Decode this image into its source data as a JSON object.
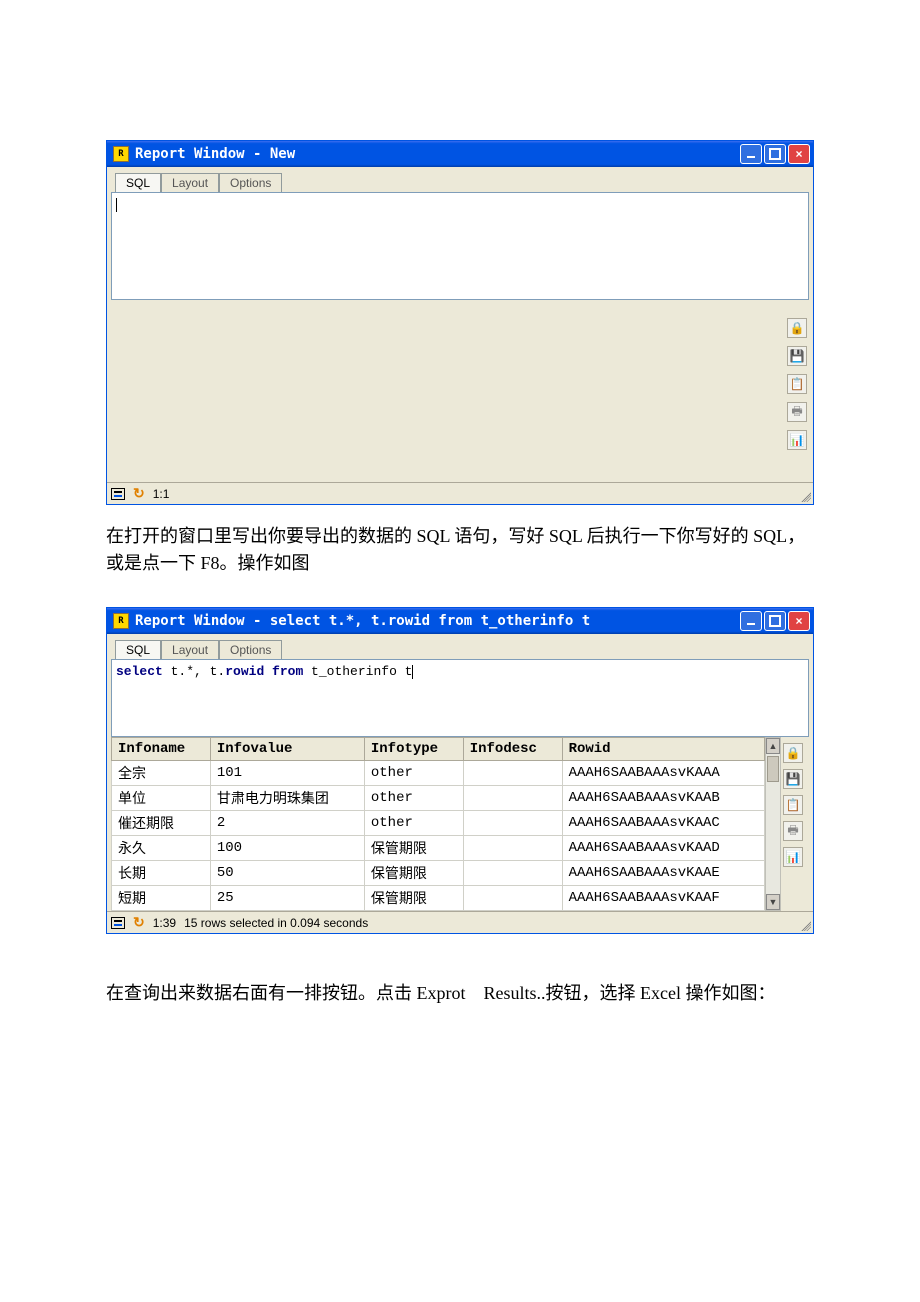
{
  "window1": {
    "title": "Report Window - New",
    "tabs": {
      "sql": "SQL",
      "layout": "Layout",
      "options": "Options"
    },
    "editor_content": "",
    "status_pos": "1:1"
  },
  "description1": "在打开的窗口里写出你要导出的数据的 SQL 语句，写好 SQL 后执行一下你写好的 SQL，或是点一下 F8。操作如图",
  "window2": {
    "title": "Report Window - select t.*, t.rowid from t_otherinfo t",
    "tabs": {
      "sql": "SQL",
      "layout": "Layout",
      "options": "Options"
    },
    "sql_parts": {
      "p1": "select",
      "p2": " t.*, t.",
      "p3": "rowid from",
      "p4": " t_otherinfo t"
    },
    "headers": {
      "infoname": "Infoname",
      "infovalue": "Infovalue",
      "infotype": "Infotype",
      "infodesc": "Infodesc",
      "rowid": "Rowid"
    },
    "rows": [
      {
        "infoname": "全宗",
        "infovalue": "101",
        "infotype": "other",
        "infodesc": "",
        "rowid": "AAAH6SAABAAAsvKAAA"
      },
      {
        "infoname": "单位",
        "infovalue": "甘肃电力明珠集团",
        "infotype": "other",
        "infodesc": "",
        "rowid": "AAAH6SAABAAAsvKAAB"
      },
      {
        "infoname": "催还期限",
        "infovalue": "2",
        "infotype": "other",
        "infodesc": "",
        "rowid": "AAAH6SAABAAAsvKAAC"
      },
      {
        "infoname": "永久",
        "infovalue": "100",
        "infotype": "保管期限",
        "infodesc": "",
        "rowid": "AAAH6SAABAAAsvKAAD"
      },
      {
        "infoname": "长期",
        "infovalue": "50",
        "infotype": "保管期限",
        "infodesc": "",
        "rowid": "AAAH6SAABAAAsvKAAE"
      },
      {
        "infoname": "短期",
        "infovalue": "25",
        "infotype": "保管期限",
        "infodesc": "",
        "rowid": "AAAH6SAABAAAsvKAAF"
      }
    ],
    "status_pos": "1:39",
    "status_message": "15 rows selected in 0.094 seconds"
  },
  "toolbar_icons": {
    "lock": "🔒",
    "save": "💾",
    "copy": "📋",
    "print": "🖶",
    "chart": "📊"
  },
  "description2": "在查询出来数据右面有一排按钮。点击 Exprot　Results..按钮，选择 Excel 操作如图："
}
